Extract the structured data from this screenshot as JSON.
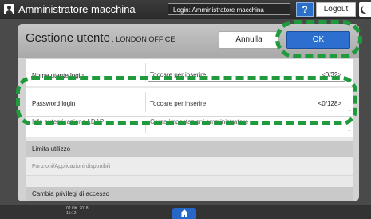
{
  "topbar": {
    "title": "Amministratore macchina",
    "login": "Login: Amministratore macchina",
    "help_label": "?",
    "logout_label": "Logout"
  },
  "dialog": {
    "title": "Gestione utente",
    "title_sub": " : LONDON OFFICE",
    "cancel_label": "Annulla",
    "ok_label": "OK"
  },
  "rows": [
    {
      "label": "Nome utente login",
      "value": "Toccare per inserire",
      "counter": "<0/32>"
    },
    {
      "label": "Password login",
      "value": "Toccare per inserire",
      "counter": "<0/128>"
    },
    {
      "label": "Info autenticazione LDAP",
      "value": "Come impostazioni amministratore"
    }
  ],
  "sections": {
    "limit_label": "Limita utilizzo",
    "functions_label": "Funzioni/Applicazioni disponibili",
    "privileges_label": "Cambia privilegi di accesso"
  },
  "bottombar": {
    "date": "02 Ott. 2018",
    "time": "15:12"
  },
  "icons": {
    "user": "user-icon",
    "moon": "energy-saver-icon",
    "home": "home-icon"
  },
  "colors": {
    "accent_blue": "#2c6fce",
    "callout_green": "#1f9a3c"
  }
}
